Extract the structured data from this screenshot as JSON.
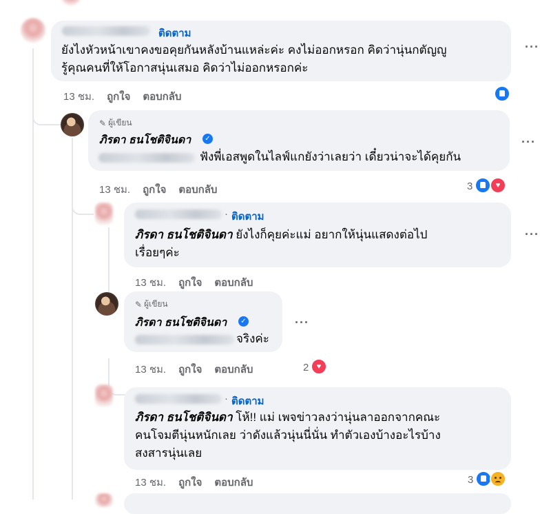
{
  "follow_label": "ติดตาม",
  "author_badge": "ผู้เขียน",
  "author_name": "ภิรดา ธนโชติจินดา",
  "actions": {
    "time": "13 ชม.",
    "like": "ถูกใจ",
    "reply": "ตอบกลับ"
  },
  "comments": [
    {
      "lines": [
        "ยังไงหัวหน้าเขาคงขอคุยกันหลังบ้านแหล่ะค่ะ คงไม่ออกหรอก คิดว่านุ่นกตัญญู",
        "รู้คุณคนที่ให้โอกาสนุ่นเสมอ คิดว่าไม่ออกหรอกค่ะ"
      ]
    },
    {
      "text": "ฟังพี่เอสพูดในไลฟ์แกยังว่าเลยว่า เดี๋ยวน่าจะได้คุยกัน",
      "reaction_count": "3"
    },
    {
      "mention": "ภิรดา ธนโชติจินดา",
      "line1": "ยังไงก็คุยค่ะแม่ อยากให้นุ่นแสดงต่อไป",
      "line2": "เรื่อยๆค่ะ"
    },
    {
      "text": "จริงค่ะ",
      "reaction_count": "2"
    },
    {
      "mention": "ภิรดา ธนโชติจินดา",
      "line1": "โห้!! แม่ เพจข่าวลงว่านุ่นลาออกจากคณะ",
      "line2": "คนโจมตีนุ่นหนักเลย ว่าดังแล้วนุ่นนี่นั่น ทำตัวเองบ้างอะไรบ้าง",
      "line3": "สงสารนุ่นเลย",
      "reaction_count": "3"
    }
  ],
  "colors": {
    "link": "#0064d1",
    "bubble": "#f0f2f5",
    "like": "#1877f2",
    "love": "#f33e58",
    "sad": "#f7b125"
  }
}
